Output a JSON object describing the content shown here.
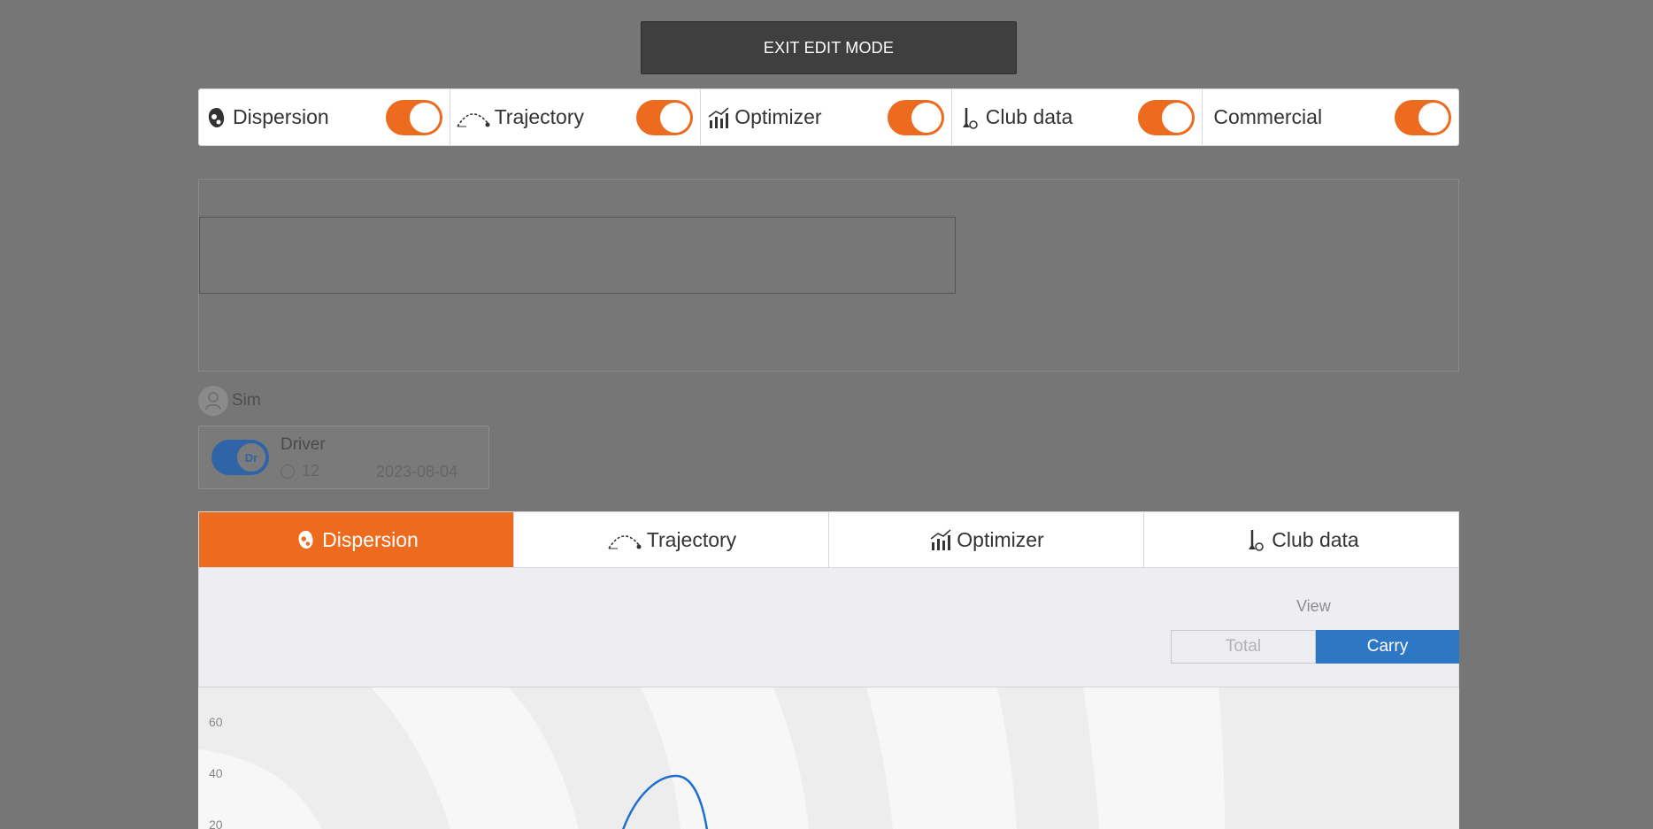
{
  "header": {
    "exit_label": "EXIT EDIT MODE"
  },
  "toggles": [
    {
      "label": "Dispersion",
      "icon": "dispersion-icon",
      "on": true
    },
    {
      "label": "Trajectory",
      "icon": "trajectory-icon",
      "on": true
    },
    {
      "label": "Optimizer",
      "icon": "optimizer-icon",
      "on": true
    },
    {
      "label": "Club data",
      "icon": "club-icon",
      "on": true
    },
    {
      "label": "Commercial",
      "icon": "",
      "on": true
    }
  ],
  "player": {
    "name": "Sim"
  },
  "club": {
    "abbr": "Dr",
    "name": "Driver",
    "count": "12",
    "date": "2023-08-04"
  },
  "tabs": [
    {
      "label": "Dispersion",
      "icon": "dispersion-icon",
      "active": true
    },
    {
      "label": "Trajectory",
      "icon": "trajectory-icon",
      "active": false
    },
    {
      "label": "Optimizer",
      "icon": "optimizer-icon",
      "active": false
    },
    {
      "label": "Club data",
      "icon": "club-icon",
      "active": false
    }
  ],
  "view": {
    "label": "View",
    "options": [
      "Total",
      "Carry"
    ],
    "selected": "Carry"
  },
  "chart_data": {
    "type": "scatter",
    "y_ticks": [
      "60",
      "40",
      "20"
    ],
    "colors": {
      "accent": "#ec6b1e",
      "selected": "#2e77c4",
      "ellipse": "#1f6fd1"
    }
  }
}
